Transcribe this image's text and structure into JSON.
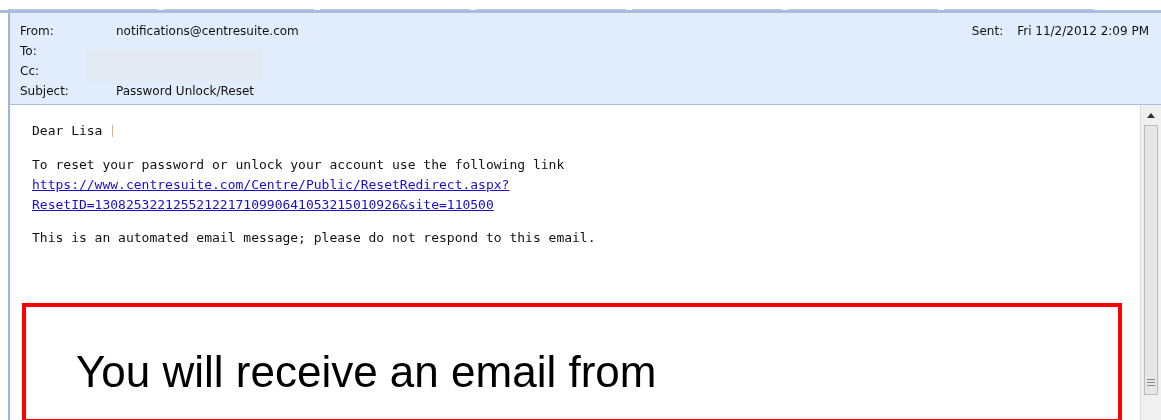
{
  "header": {
    "fields": [
      {
        "label": "From:",
        "value": "notifications@centresuite.com"
      },
      {
        "label": "To:",
        "redacted": true
      },
      {
        "label": "Cc:"
      },
      {
        "label": "Subject:",
        "value": "Password Unlock/Reset"
      }
    ],
    "sent": {
      "label": "Sent:",
      "value": "Fri 11/2/2012 2:09 PM"
    }
  },
  "body": {
    "greeting": "Dear Lisa",
    "intro": "To reset your password or unlock your account use the following link",
    "link_lines": [
      "https://www.centresuite.com/Centre/Public/ResetRedirect.aspx?",
      "ResetID=130825322125521221710990641053215010926&site=110500"
    ],
    "notice": "This is an automated email message; please do not respond to this email."
  },
  "callout": {
    "text": "You will receive an email from"
  }
}
